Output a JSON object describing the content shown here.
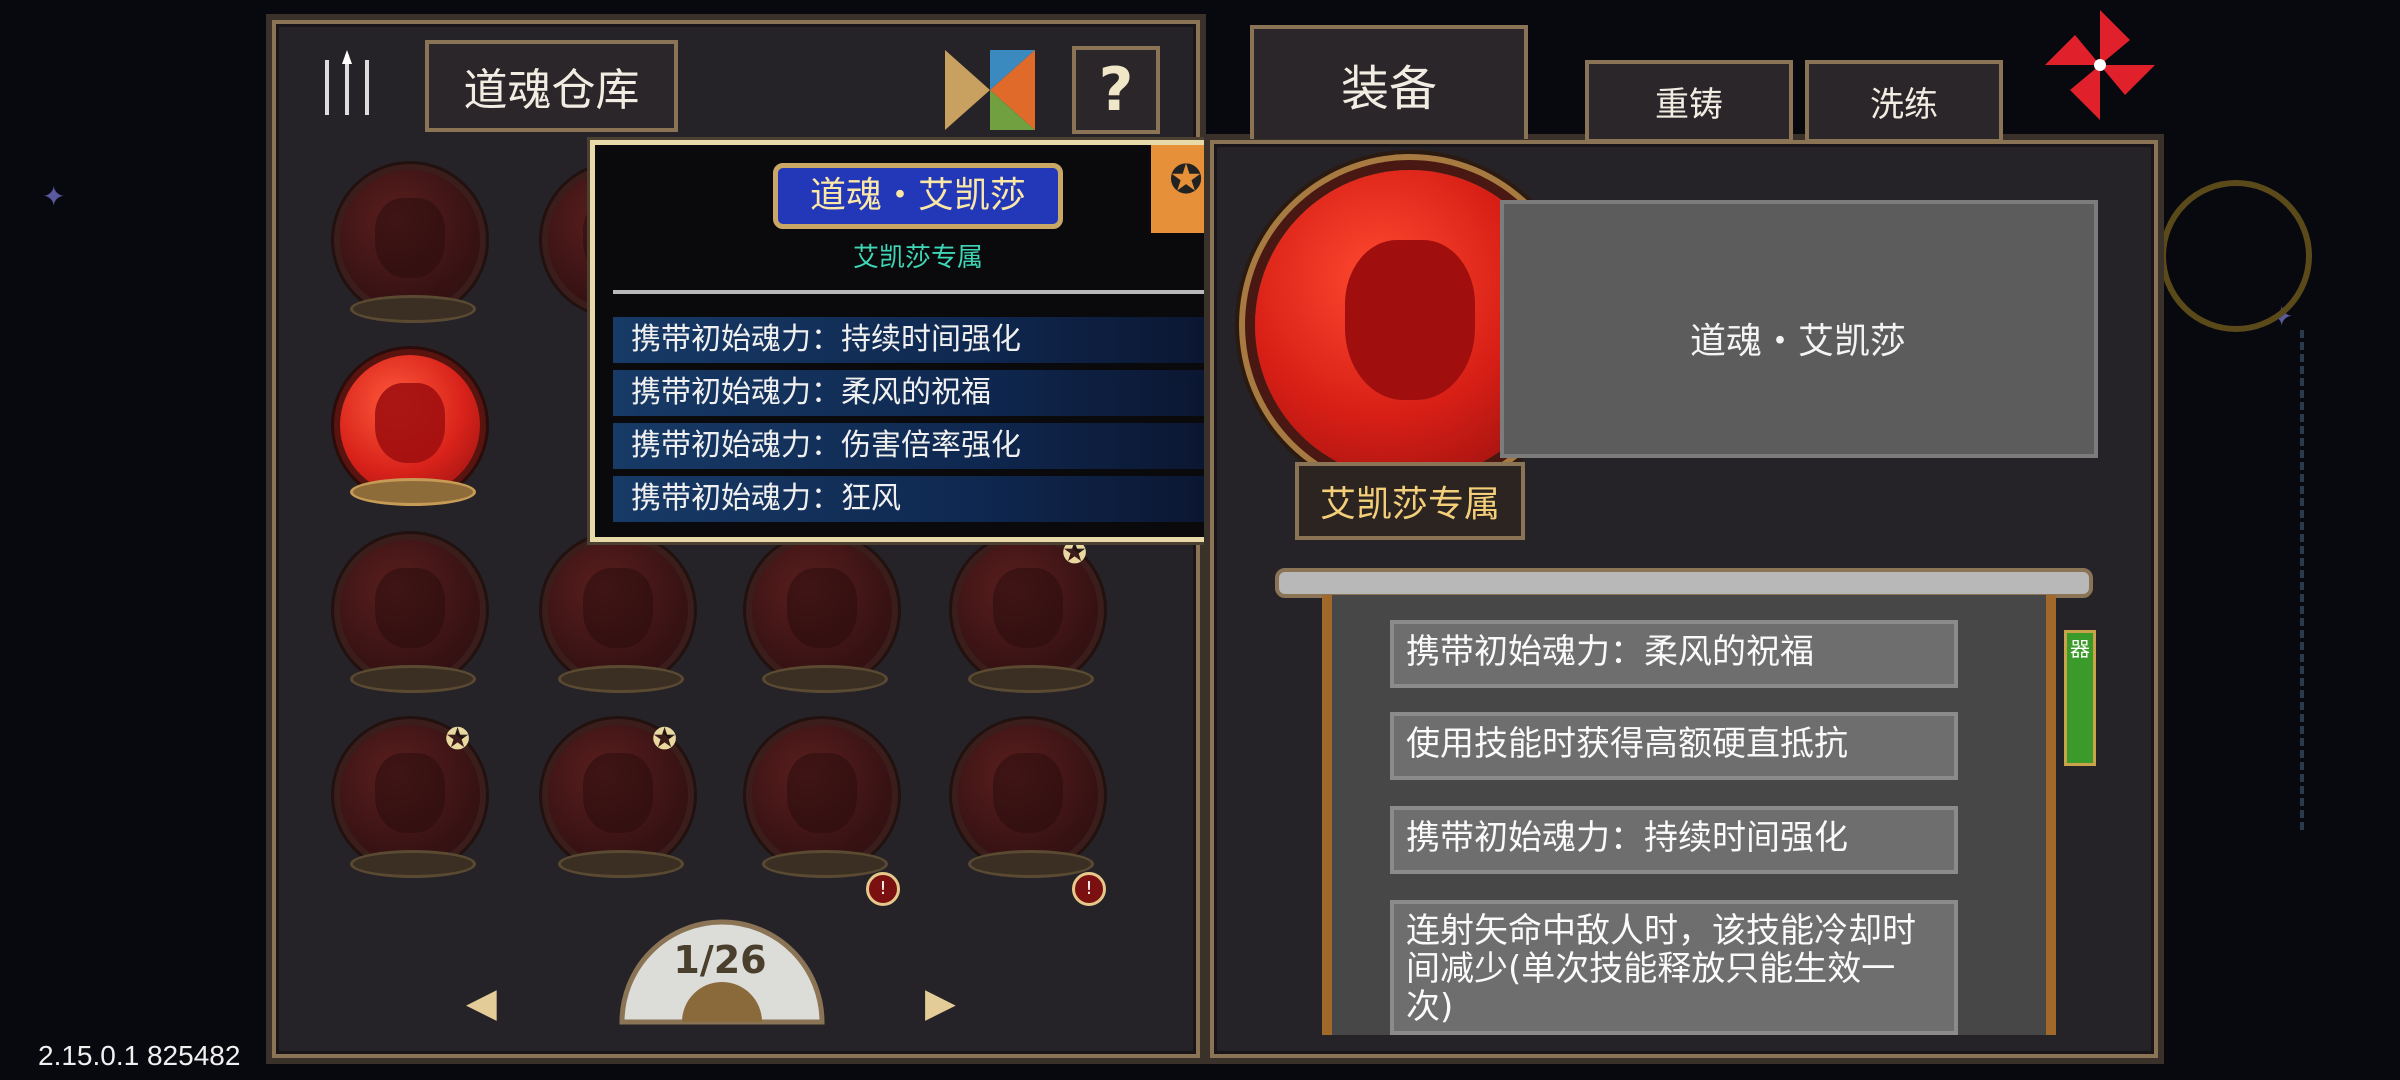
{
  "left_panel": {
    "title": "道魂仓库",
    "help_label": "?",
    "page_indicator": "1/26",
    "prev_arrow": "◀",
    "next_arrow": "▶"
  },
  "tooltip": {
    "title": "道魂・艾凯莎",
    "subtitle": "艾凯莎专属",
    "abilities": [
      "携带初始魂力：持续时间强化",
      "携带初始魂力：柔风的祝福",
      "携带初始魂力：伤害倍率强化",
      "携带初始魂力：狂风"
    ]
  },
  "tabs": {
    "equip": "装备",
    "recast": "重铸",
    "refine": "洗练"
  },
  "detail": {
    "name": "道魂・艾凯莎",
    "exclusive": "艾凯莎专属",
    "effects": [
      "携带初始魂力：柔风的祝福",
      "使用技能时获得高额硬直抵抗",
      "携带初始魂力：持续时间强化",
      "连射矢命中敌人时，该技能冷却时间减少(单次技能释放只能生效一次)"
    ],
    "side_tag": "器"
  },
  "version": "2.15.0.1 825482",
  "icons": [
    "spears-icon",
    "tangram-icon",
    "help-icon",
    "pinwheel-icon",
    "star-badge-icon",
    "lock-badge-icon",
    "fan-icon"
  ],
  "colors": {
    "accent_gold": "#e8d9a8",
    "orb_red": "#d8221a",
    "ability_blue": "#173a66"
  }
}
